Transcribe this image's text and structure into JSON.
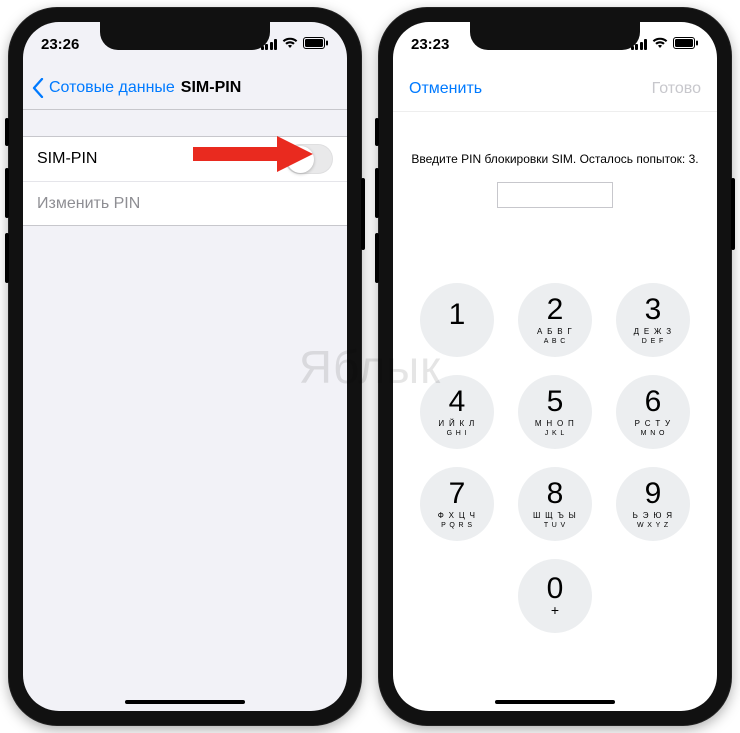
{
  "watermark": "Яблык",
  "left": {
    "status_time": "23:26",
    "nav_back_label": "Сотовые данные",
    "nav_title": "SIM-PIN",
    "cells": {
      "sim_pin_label": "SIM-PIN",
      "change_pin_label": "Изменить PIN"
    }
  },
  "right": {
    "status_time": "23:23",
    "modal": {
      "cancel_label": "Отменить",
      "done_label": "Готово"
    },
    "prompt": "Введите PIN блокировки SIM. Осталось попыток: 3.",
    "keypad": [
      {
        "digit": "1",
        "letters_ru": "",
        "letters_en": ""
      },
      {
        "digit": "2",
        "letters_ru": "А Б В Г",
        "letters_en": "A B C"
      },
      {
        "digit": "3",
        "letters_ru": "Д Е Ж З",
        "letters_en": "D E F"
      },
      {
        "digit": "4",
        "letters_ru": "И Й К Л",
        "letters_en": "G H I"
      },
      {
        "digit": "5",
        "letters_ru": "М Н О П",
        "letters_en": "J K L"
      },
      {
        "digit": "6",
        "letters_ru": "Р С Т У",
        "letters_en": "M N O"
      },
      {
        "digit": "7",
        "letters_ru": "Ф Х Ц Ч",
        "letters_en": "P Q R S"
      },
      {
        "digit": "8",
        "letters_ru": "Ш Щ Ъ Ы",
        "letters_en": "T U V"
      },
      {
        "digit": "9",
        "letters_ru": "Ь Э Ю Я",
        "letters_en": "W X Y Z"
      },
      {
        "digit": "0",
        "letters_ru": "",
        "letters_en": "+"
      }
    ]
  }
}
